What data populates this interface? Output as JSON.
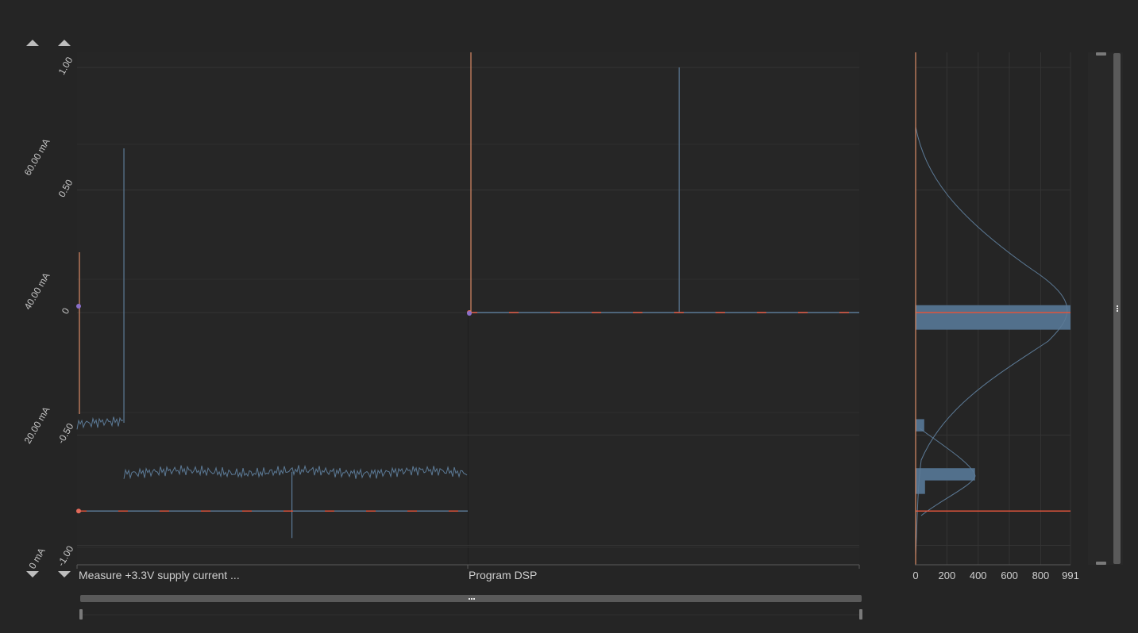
{
  "colors": {
    "background": "#252525",
    "grid": "#343434",
    "trace": "#5c7a96",
    "histogram_fill": "#52708c",
    "limit_line": "#e0543c",
    "marker": "#e26a5a",
    "marker_purple": "#8a6fc8",
    "cursor": "#d98a66",
    "scrollbar": "#5a5a5a"
  },
  "icons": {
    "zoom_in_y1": "triangle-up-icon",
    "zoom_in_y2": "triangle-up-icon",
    "zoom_out_y1": "triangle-down-icon",
    "zoom_out_y2": "triangle-down-icon",
    "scroll_grip": "grip-dots-icon"
  },
  "chart_data": {
    "type": "line",
    "y_left_ticks": [
      "1.00",
      "0.50",
      "0",
      "-0.50",
      "-1.00"
    ],
    "y_left_range": [
      -1.0,
      1.0
    ],
    "y_current_ticks": [
      "60.00 mA",
      "40.00 mA",
      "20.00 mA",
      "0 mA"
    ],
    "x_categories": [
      "Measure +3.3V supply current ...",
      "Program DSP"
    ],
    "segments": [
      {
        "category": "Measure +3.3V supply current ...",
        "trace_levels": [
          {
            "from": 0.0,
            "to": 0.12,
            "level": -0.45
          },
          {
            "from": 0.12,
            "to": 1.0,
            "level": -0.65
          }
        ],
        "spikes": [
          {
            "at": 0.12,
            "peak": 0.67
          },
          {
            "at": 0.55,
            "peak": -0.92
          }
        ],
        "limit_level": -0.81
      },
      {
        "category": "Program DSP",
        "trace_levels": [
          {
            "from": 0.0,
            "to": 1.0,
            "level": 0.0
          }
        ],
        "spikes": [
          {
            "at": 0.54,
            "peak": 1.0
          }
        ],
        "limit_level": 0.0
      }
    ],
    "histogram": {
      "x_ticks": [
        "0",
        "200",
        "400",
        "600",
        "800",
        "991"
      ],
      "x_range": [
        0,
        991
      ],
      "bins": [
        {
          "level": -0.02,
          "height": 0.1,
          "count": 991
        },
        {
          "level": -0.46,
          "height": 0.05,
          "count": 55
        },
        {
          "level": -0.66,
          "height": 0.05,
          "count": 380
        },
        {
          "level": -0.69,
          "height": 0.1,
          "count": 60
        }
      ],
      "limit_levels": [
        0.0,
        -0.81
      ]
    }
  }
}
